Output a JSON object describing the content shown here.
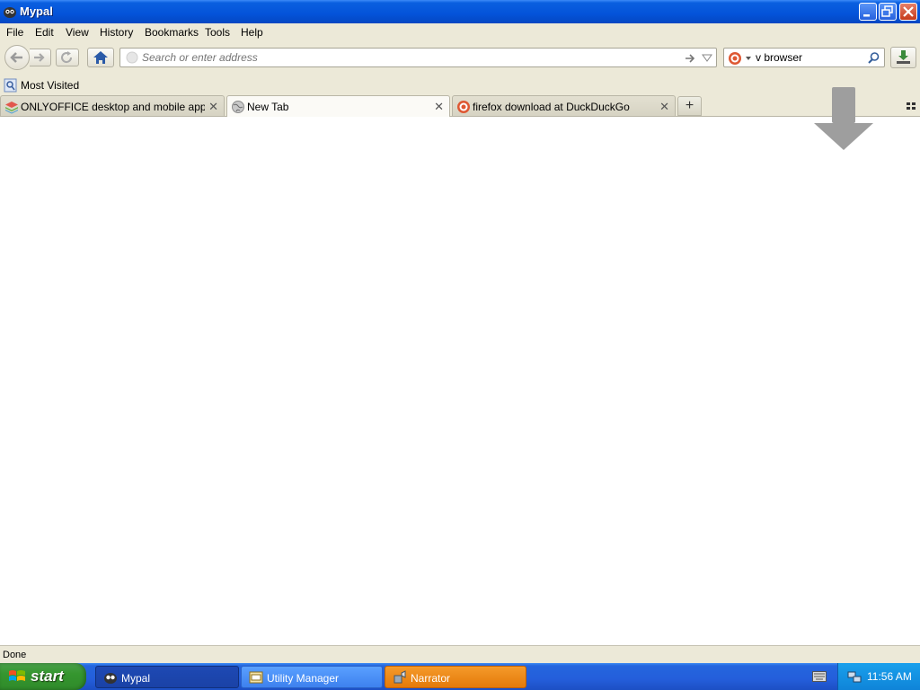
{
  "window": {
    "title": "Mypal"
  },
  "menu": [
    "File",
    "Edit",
    "View",
    "History",
    "Bookmarks",
    "Tools",
    "Help"
  ],
  "navbar": {
    "url_placeholder": "Search or enter address",
    "url_value": "",
    "search_value": "v browser"
  },
  "bookmarks": {
    "most_visited": "Most Visited"
  },
  "tabs": [
    {
      "label": "ONLYOFFICE desktop and mobile apps | ...",
      "selected": false
    },
    {
      "label": "New Tab",
      "selected": true
    },
    {
      "label": "firefox download at DuckDuckGo",
      "selected": false
    }
  ],
  "status": {
    "text": "Done"
  },
  "taskbar": {
    "start": "start",
    "tasks": [
      "Mypal",
      "Utility Manager",
      "Narrator"
    ],
    "clock": "11:56 AM"
  },
  "colors": {
    "titlebar": "#0453d9",
    "chrome": "#ece9d8",
    "taskbar": "#245edb",
    "start_green": "#35962f",
    "narrator_orange": "#e47a0a"
  }
}
